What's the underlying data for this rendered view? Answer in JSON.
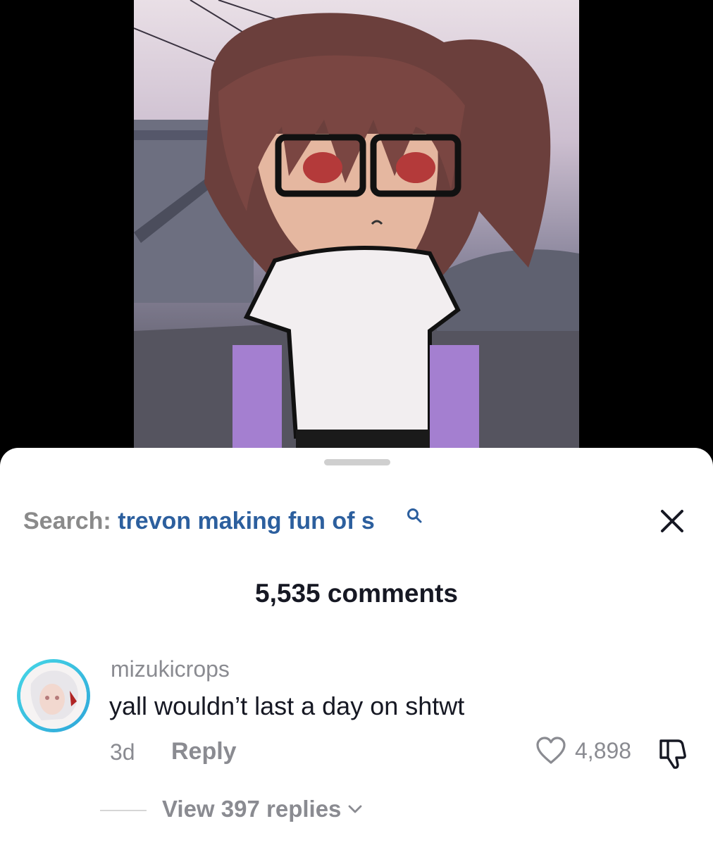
{
  "search": {
    "label": "Search:",
    "query": "trevon making fun of s"
  },
  "comments": {
    "count_label": "5,535 comments"
  },
  "comment": {
    "username": "mizukicrops",
    "text": "yall wouldn’t last a day on shtwt",
    "time": "3d",
    "reply_label": "Reply",
    "like_count": "4,898",
    "view_replies_label": "View 397 replies"
  },
  "colors": {
    "search_query": "#2c5f9e",
    "avatar_ring": "#3bbfe0",
    "muted_text": "#8a8b91"
  },
  "icons": [
    "search-icon",
    "close-icon",
    "heart-icon",
    "dislike-icon",
    "chevron-down-icon"
  ]
}
